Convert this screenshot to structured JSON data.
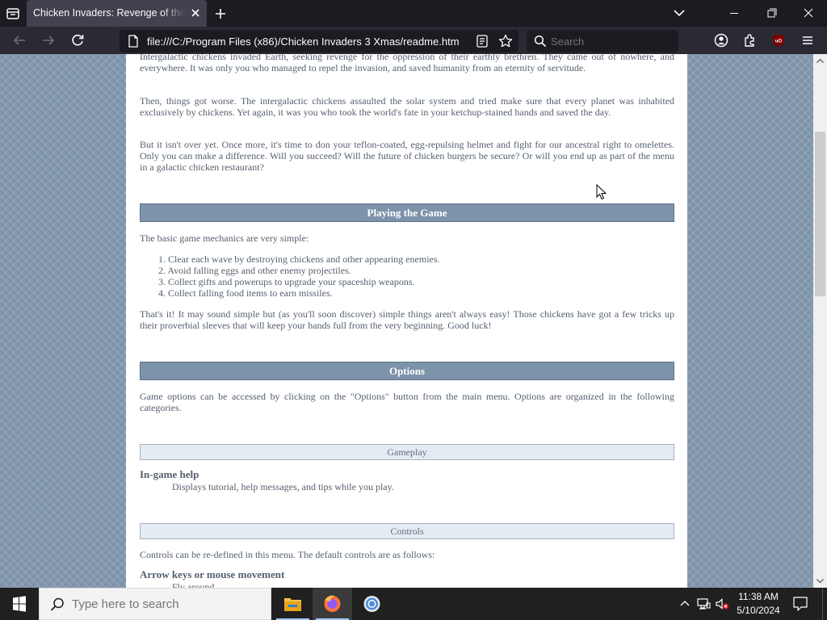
{
  "browser": {
    "tab_title": "Chicken Invaders: Revenge of the Yolk",
    "url": "file:///C:/Program Files (x86)/Chicken Invaders 3 Xmas/readme.htm",
    "search_placeholder": "Search"
  },
  "page": {
    "intro_paragraphs": [
      "Intergalactic chickens invaded Earth, seeking revenge for the oppression of their earthly brethren. They came out of nowhere, and everywhere. It was only you who managed to repel the invasion, and saved humanity from an eternity of servitude.",
      "Then, things got worse. The intergalactic chickens assaulted the solar system and tried make sure that every planet was inhabited exclusively by chickens. Yet again, it was you who took the world's fate in your ketchup-stained hands and saved the day.",
      "But it isn't over yet. Once more, it's time to don your teflon-coated, egg-repulsing helmet and fight for our ancestral right to omelettes. Only you can make a difference. Will you succeed? Will the future of chicken burgers be secure? Or will you end up as part of the menu in a galactic chicken restaurant?"
    ],
    "playing": {
      "heading": "Playing the Game",
      "intro": "The basic game mechanics are very simple:",
      "steps": [
        "1. Clear each wave by destroying chickens and other appearing enemies.",
        "2. Avoid falling eggs and other enemy projectiles.",
        "3. Collect gifts and powerups to upgrade your spaceship weapons.",
        "4. Collect falling food items to earn missiles."
      ],
      "outro": "That's it! It may sound simple but (as you'll soon discover) simple things aren't always easy! Those chickens have got a few tricks up their proverbial sleeves that will keep your hands full from the very beginning. Good luck!"
    },
    "options": {
      "heading": "Options",
      "intro": "Game options can be accessed by clicking on the \"Options\" button from the main menu. Options are organized in the following categories.",
      "gameplay_heading": "Gameplay",
      "ingame_help_term": "In-game help",
      "ingame_help_desc": "Displays tutorial, help messages, and tips while you play.",
      "controls_heading": "Controls",
      "controls_intro": "Controls can be re-defined in this menu. The default controls are as follows:",
      "arrow_term": "Arrow keys or mouse movement",
      "arrow_desc": "Fly around"
    }
  },
  "taskbar": {
    "search_placeholder": "Type here to search",
    "time": "11:38 AM",
    "date": "5/10/2024"
  },
  "colors": {
    "page_background": "#7d93aa",
    "section_header": "#7d93aa",
    "body_text": "#55606e",
    "browser_frame": "#1c1b22"
  },
  "icons": [
    "tab-list-icon",
    "close-icon",
    "plus-icon",
    "chevron-down-icon",
    "minimize-icon",
    "maximize-icon",
    "back-icon",
    "forward-icon",
    "reload-icon",
    "page-icon",
    "reader-view-icon",
    "star-icon",
    "search-icon",
    "account-icon",
    "extensions-icon",
    "ublock-icon",
    "menu-icon",
    "windows-logo-icon",
    "file-explorer-icon",
    "firefox-icon",
    "chrome-icon",
    "chevron-up-icon",
    "network-icon",
    "volume-muted-icon",
    "notification-icon"
  ]
}
